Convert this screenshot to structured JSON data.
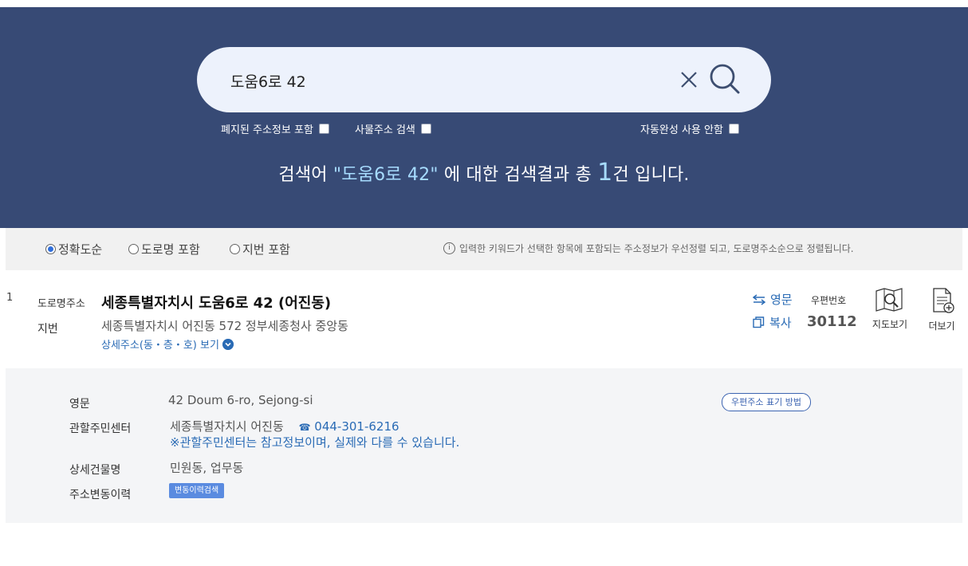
{
  "search": {
    "value": "도움6로 42",
    "clear_label": "×",
    "options": {
      "include_abolished": "폐지된 주소정보 포함",
      "object_address": "사물주소 검색",
      "no_autocomplete": "자동완성 사용 안함"
    }
  },
  "summary": {
    "prefix": "검색어 ",
    "keyword": "\"도움6로 42\"",
    "middle": " 에 대한 검색결과 총 ",
    "count": "1",
    "suffix": "건 입니다."
  },
  "sort": {
    "options": [
      "정확도순",
      "도로명 포함",
      "지번 포함"
    ],
    "selected": "정확도순",
    "info_icon": "i",
    "info": "입력한 키워드가 선택한 항목에 포함되는 주소정보가 우선정렬 되고, 도로명주소순으로 정렬됩니다."
  },
  "result": {
    "number": "1",
    "road_label": "도로명주소",
    "road_address": "세종특별자치시 도움6로 42 (어진동)",
    "jibun_label": "지번",
    "jibun_address": "세종특별자치시 어진동 572 정부세종청사 중앙동",
    "detail_link": "상세주소(동・층・호) 보기",
    "english_btn": "영문",
    "copy_btn": "복사",
    "postal_label": "우편번호",
    "postal_code": "30112",
    "map_btn": "지도보기",
    "more_btn": "더보기"
  },
  "details": {
    "english_label": "영문",
    "english_value": "42 Doum 6-ro, Sejong-si",
    "postal_method": "우편주소 표기 방법",
    "center_label": "관할주민센터",
    "center_value": "세종특별자치시 어진동",
    "phone": "044-301-6216",
    "note": "※관할주민센터는 참고정보이며, 실제와 다를 수 있습니다.",
    "building_label": "상세건물명",
    "building_value": "민원동, 업무동",
    "history_label": "주소변동이력",
    "history_btn": "변동이력검색"
  },
  "colors": {
    "hero_bg": "#374a75",
    "accent_blue": "#2a6bb5",
    "highlight": "#a7dcff"
  }
}
